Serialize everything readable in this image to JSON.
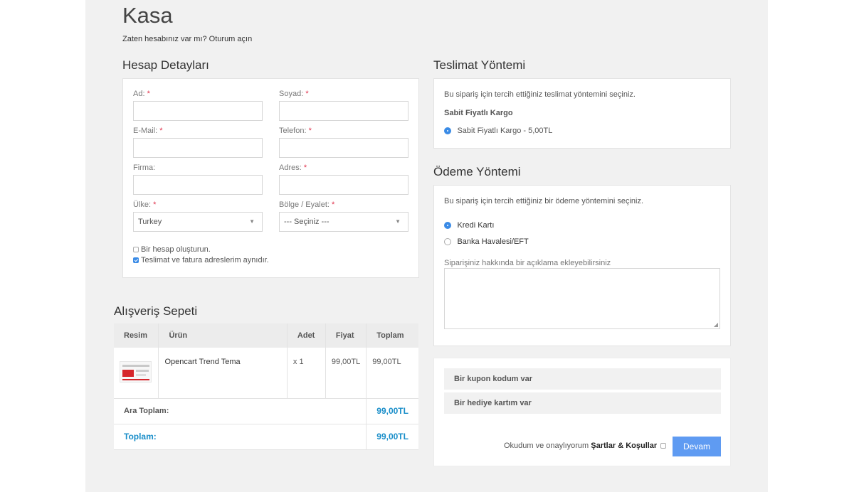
{
  "page": {
    "title": "Kasa",
    "login_prompt": "Zaten hesabınız var mı? Oturum açın"
  },
  "account": {
    "title": "Hesap Detayları",
    "fields": {
      "first_name": "Ad:",
      "last_name": "Soyad:",
      "email": "E-Mail:",
      "phone": "Telefon:",
      "company": "Firma:",
      "address": "Adres:",
      "country": "Ülke:",
      "region": "Bölge / Eyalet:"
    },
    "required_mark": "*",
    "country_value": "Turkey",
    "region_value": "--- Seçiniz ---",
    "create_account": {
      "label": "Bir hesap oluşturun.",
      "checked": false
    },
    "same_address": {
      "label": "Teslimat ve fatura adreslerim aynıdır.",
      "checked": true
    }
  },
  "shipping": {
    "title": "Teslimat Yöntemi",
    "description": "Bu sipariş için tercih ettiğiniz teslimat yöntemini seçiniz.",
    "group": "Sabit Fiyatlı Kargo",
    "option": "Sabit Fiyatlı Kargo - 5,00TL"
  },
  "payment": {
    "title": "Ödeme Yöntemi",
    "description": "Bu sipariş için tercih ettiğiniz bir ödeme yöntemini seçiniz.",
    "options": [
      "Kredi Kartı",
      "Banka Havalesi/EFT"
    ],
    "selected": 0,
    "comment_label": "Siparişiniz hakkında bir açıklama ekleyebilirsiniz"
  },
  "cart": {
    "title": "Alışveriş Sepeti",
    "headers": [
      "Resim",
      "Ürün",
      "Adet",
      "Fiyat",
      "Toplam"
    ],
    "item": {
      "product": "Opencart Trend Tema",
      "qty": "x 1",
      "price": "99,00TL",
      "total": "99,00TL"
    },
    "subtotal_label": "Ara Toplam:",
    "subtotal": "99,00TL",
    "total_label": "Toplam:",
    "total": "99,00TL"
  },
  "extras": {
    "coupon": "Bir kupon kodum var",
    "gift": "Bir hediye kartım var"
  },
  "confirm": {
    "prefix": "Okudum ve onaylıyorum",
    "terms": "Şartlar & Koşullar",
    "button": "Devam"
  },
  "colors": {
    "accent": "#5f9bf2",
    "total_blue": "#1a8ec9",
    "required": "#e0314b"
  }
}
